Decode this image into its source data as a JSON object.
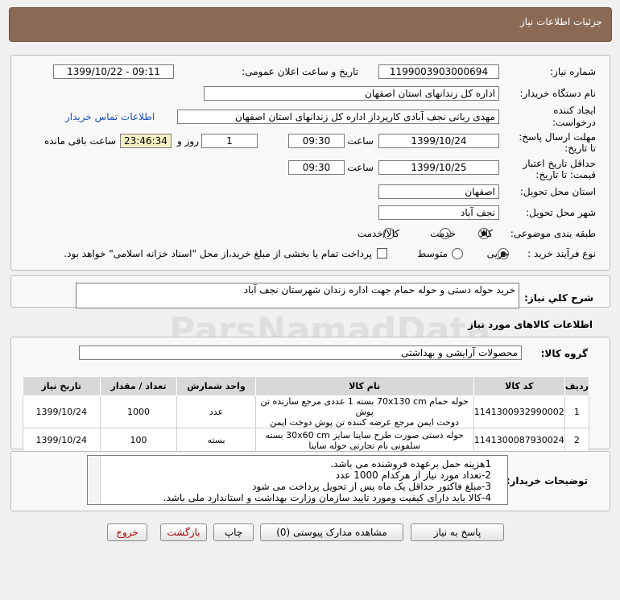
{
  "header": {
    "title": "جزئیات اطلاعات نیاز"
  },
  "info": {
    "need_number_label": "شماره نیاز:",
    "need_number": "1199003903000694",
    "announce_label": "تاریخ و ساعت اعلان عمومی:",
    "announce_value": "1399/10/22 - 09:11",
    "buyer_org_label": "نام دستگاه خریدار:",
    "buyer_org": "اداره کل زندانهای استان اصفهان",
    "creator_label_1": "ایجاد کننده",
    "creator_label_2": "درخواست:",
    "creator": "مهدی ربانی نجف آبادی کارپرداز اداره کل زندانهای استان اصفهان",
    "contact_link": "اطلاعات تماس خریدار",
    "deadline_label_1": "مهلت ارسال پاسخ:",
    "deadline_label_2": "تا تاریخ:",
    "deadline_date": "1399/10/24",
    "time_label": "ساعت",
    "deadline_time": "09:30",
    "days_value": "1",
    "days_label": "روز و",
    "remaining_time": "23:46:34",
    "remaining_label": "ساعت باقی مانده",
    "validity_label_1": "حداقل تاریخ اعتبار",
    "validity_label_2": "قیمت: تا تاریخ:",
    "validity_date": "1399/10/25",
    "validity_time": "09:30",
    "province_label": "استان محل تحویل:",
    "province": "اصفهان",
    "city_label": "شهر محل تحویل:",
    "city": "نجف آباد",
    "category_label": "طبقه بندی موضوعی:",
    "category_options": [
      "کالا",
      "خدمت",
      "کالا/خدمت"
    ],
    "purchase_type_label": "نوع فرآیند خرید :",
    "purchase_options": [
      "جزیی",
      "متوسط"
    ],
    "payment_note": "پرداخت تمام یا بخشی از مبلغ خرید،از محل \"اسناد خزانه اسلامی\" خواهد بود."
  },
  "summary": {
    "label": "شرح کلي نياز:",
    "text": "خرید حوله دستی و حوله حمام جهت اداره زندان شهرستان نجف آباد"
  },
  "goods": {
    "section_title": "اطلاعات کالاهای مورد نیاز",
    "group_label": "گروه کالا:",
    "group_value": "محصولات آرایشی و بهداشتی",
    "columns": [
      "ردیف",
      "کد کالا",
      "نام کالا",
      "واحد شمارش",
      "تعداد / مقدار",
      "تاریخ نیاز"
    ],
    "rows": [
      {
        "row": "1",
        "code": "1141300932990002",
        "name_1": "حوله حمام 70x130 cm بسته 1 عددی مرجع سازنده تن پوش",
        "name_2": "دوخت ایمن مرجع عرضه کننده تن پوش دوخت ایمن",
        "unit": "عدد",
        "qty": "1000",
        "date": "1399/10/24"
      },
      {
        "row": "2",
        "code": "1141300087930024",
        "name_1": "حوله دستی صورت طرح ساینا سایز 30x60 cm بسته",
        "name_2": "سلفونی نام تجارتی حوله ساینا",
        "unit": "بسته",
        "qty": "100",
        "date": "1399/10/24"
      }
    ]
  },
  "buyer_notes": {
    "label": "توضیحات خریدار:",
    "lines": [
      "1هزینه حمل برعهده فروشنده می باشد.",
      "2-تعداد مورد نیاز از هرکدام 1000 عدد",
      "3-مبلغ فاکتور حداقل یک ماه پس از تحویل پرداخت می شود",
      "4-کالا باید دارای کیفیت ومورد تایید سازمان وزارت بهداشت و استاندارد ملی باشد."
    ]
  },
  "buttons": {
    "reply": "پاسخ به نیاز",
    "attachments": "مشاهده مدارک پیوستی (0)",
    "print": "چاپ",
    "back": "بازگشت",
    "exit": "خروج"
  },
  "watermark": {
    "text": "ParsNamadData"
  }
}
